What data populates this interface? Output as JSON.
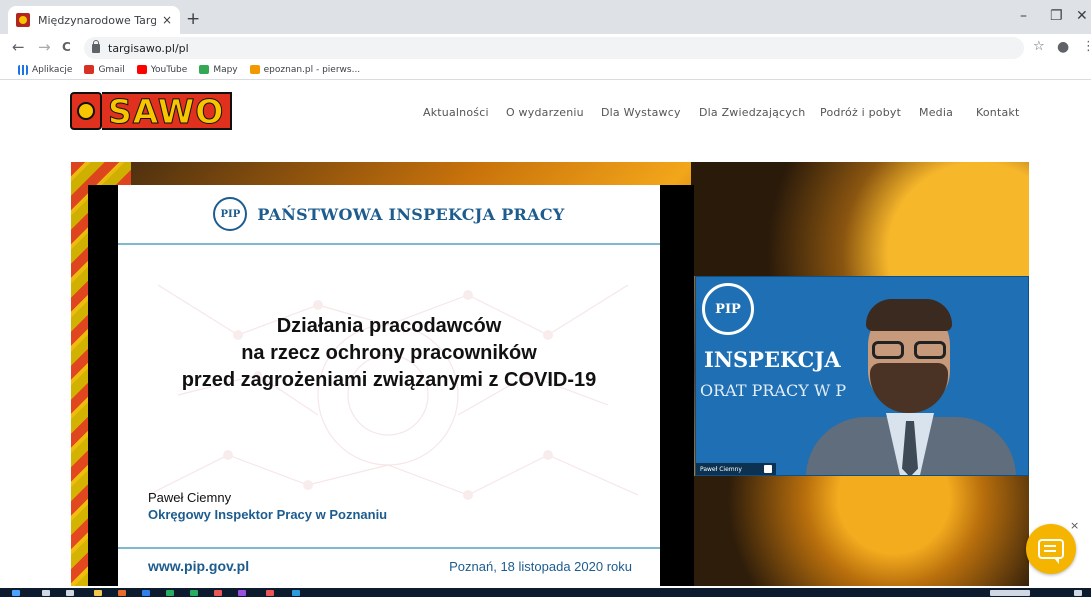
{
  "browser": {
    "tab_title": "Międzynarodowe Targi SAWO",
    "tab_close": "×",
    "new_tab": "+",
    "url": "targisawo.pl/pl",
    "minimize": "–",
    "restore": "❐",
    "close": "✕",
    "back": "←",
    "forward": "→",
    "reload": "C",
    "star": "☆",
    "profile": "●",
    "menu": "⋮",
    "bookmarks": [
      {
        "label": "Aplikacje",
        "icon": "apps-grid-icon",
        "color": "#1a73e8"
      },
      {
        "label": "Gmail",
        "icon": "gmail-icon",
        "color": "#d93025"
      },
      {
        "label": "YouTube",
        "icon": "youtube-icon",
        "color": "#ff0000"
      },
      {
        "label": "Mapy",
        "icon": "maps-icon",
        "color": "#34a853"
      },
      {
        "label": "epoznan.pl - pierws...",
        "icon": "epoznan-icon",
        "color": "#f29900"
      }
    ]
  },
  "site": {
    "logo_text": "SAWO",
    "menu": [
      {
        "label": "Aktualności",
        "id": "aktualnosci"
      },
      {
        "label": "O wydarzeniu",
        "id": "o-wydarzeniu"
      },
      {
        "label": "Dla Wystawcy",
        "id": "dla-wystawcy"
      },
      {
        "label": "Dla Zwiedzających",
        "id": "dla-zwiedzajacych"
      },
      {
        "label": "Podróż i pobyt",
        "id": "podroz-i-pobyt"
      },
      {
        "label": "Media",
        "id": "media"
      },
      {
        "label": "Kontakt",
        "id": "kontakt"
      }
    ]
  },
  "slide": {
    "org_name": "PAŃSTWOWA INSPEKCJA PRACY",
    "logo_glyph": "PIP",
    "title_lines": [
      "Działania pracodawców",
      "na rzecz ochrony pracowników",
      "przed zagrożeniami związanymi z COVID-19"
    ],
    "presenter_name": "Paweł Ciemny",
    "presenter_role": "Okręgowy Inspektor Pracy w Poznaniu",
    "footer_url": "www.pip.gov.pl",
    "footer_date": "Poznań, 18 listopada 2020 roku"
  },
  "video": {
    "backdrop_line1": "INSPEKCJA",
    "backdrop_line2": "ORAT PRACY W P",
    "participant_name": "Paweł Ciemny",
    "logo_glyph": "PIP"
  },
  "chat": {
    "close": "×"
  },
  "colors": {
    "brand_red": "#e0301e",
    "brand_yellow": "#f7c600",
    "pip_blue": "#1d5c8e",
    "chat_yellow": "#f4b400"
  }
}
